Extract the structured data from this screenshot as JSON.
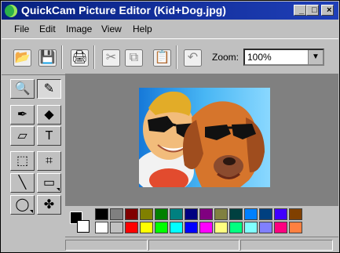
{
  "window": {
    "title": "QuickCam Picture Editor (Kid+Dog.jpg)",
    "controls": [
      "_",
      "□",
      "×"
    ]
  },
  "menu": [
    "File",
    "Edit",
    "Image",
    "View",
    "Help"
  ],
  "toolbar": {
    "zoom_label": "Zoom:",
    "zoom_value": "100%",
    "icons": [
      "open-folder-icon",
      "save-icon",
      "print-icon",
      "cut-icon",
      "copy-icon",
      "paste-icon",
      "undo-icon"
    ]
  },
  "tools": {
    "active": "pencil",
    "items": [
      "zoom",
      "pencil",
      "eyedropper",
      "fill",
      "eraser",
      "text",
      "rectangle-select",
      "crop",
      "line",
      "rectangle",
      "ellipse",
      "stamp"
    ]
  },
  "palette": {
    "foreground": "#000000",
    "background": "#ffffff",
    "colors": [
      "#000000",
      "#808080",
      "#800000",
      "#808000",
      "#008000",
      "#008080",
      "#000080",
      "#800080",
      "#808040",
      "#004040",
      "#0080ff",
      "#004080",
      "#4000ff",
      "#804000",
      "#ffffff",
      "#c0c0c0",
      "#ff0000",
      "#ffff00",
      "#00ff00",
      "#00ffff",
      "#0000ff",
      "#ff00ff",
      "#ffff80",
      "#00ff80",
      "#80ffff",
      "#8080ff",
      "#ff0080",
      "#ff8040"
    ]
  }
}
